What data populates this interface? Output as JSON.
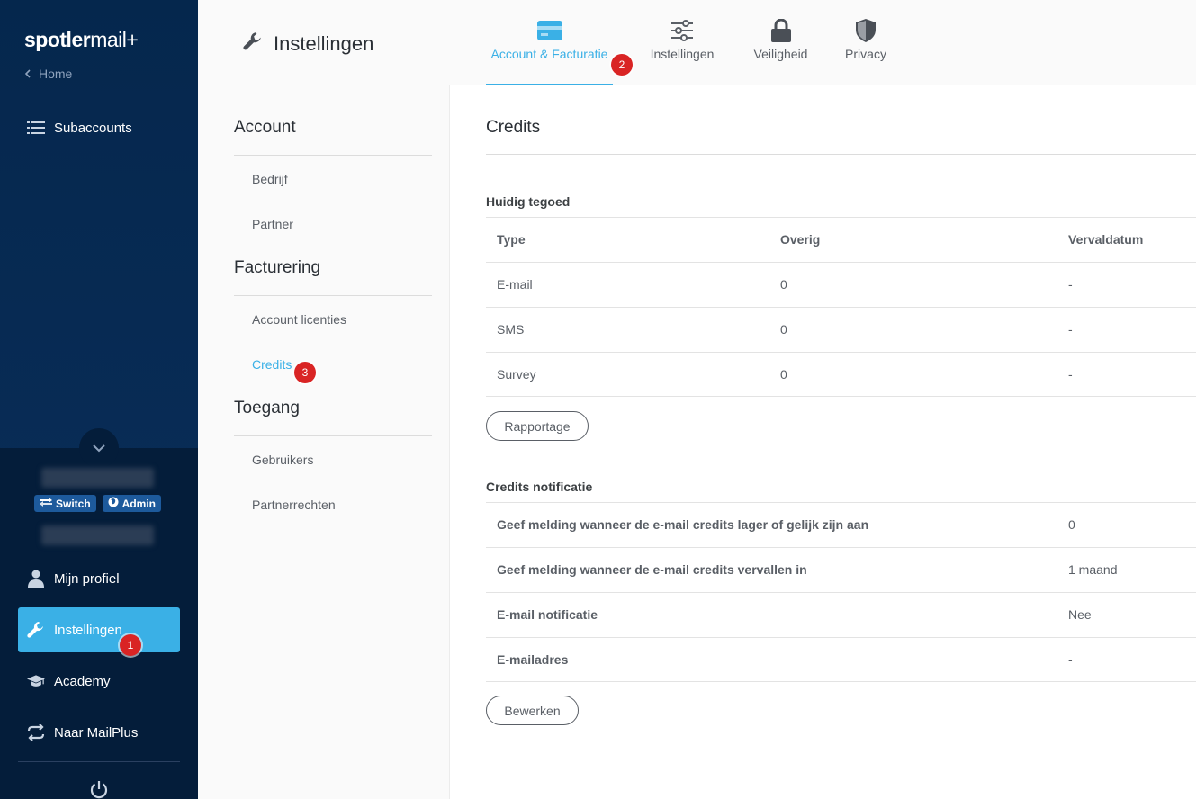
{
  "sidebar": {
    "logo_bold": "spotler",
    "logo_light": "mail+",
    "home_label": "Home",
    "top_items": [
      {
        "label": "Subaccounts",
        "icon": "list-icon"
      }
    ],
    "chips": [
      {
        "label": "Switch",
        "icon": "switch-icon"
      },
      {
        "label": "Admin",
        "icon": "globe-icon"
      }
    ],
    "bottom_items": [
      {
        "label": "Mijn profiel",
        "icon": "user-icon"
      },
      {
        "label": "Instellingen",
        "icon": "wrench-icon",
        "active": true
      },
      {
        "label": "Academy",
        "icon": "graduation-cap-icon"
      },
      {
        "label": "Naar MailPlus",
        "icon": "arrows-swap-icon"
      }
    ]
  },
  "header": {
    "title": "Instellingen",
    "tabs": [
      {
        "label": "Account & Facturatie",
        "icon": "credit-card-icon",
        "active": true
      },
      {
        "label": "Instellingen",
        "icon": "sliders-icon"
      },
      {
        "label": "Veiligheid",
        "icon": "lock-icon"
      },
      {
        "label": "Privacy",
        "icon": "shield-icon"
      }
    ]
  },
  "subnav": {
    "groups": [
      {
        "title": "Account",
        "links": [
          "Bedrijf",
          "Partner"
        ]
      },
      {
        "title": "Facturering",
        "links": [
          "Account licenties",
          "Credits"
        ]
      },
      {
        "title": "Toegang",
        "links": [
          "Gebruikers",
          "Partnerrechten"
        ]
      }
    ],
    "active_link": "Credits"
  },
  "main": {
    "title": "Credits",
    "balance": {
      "heading": "Huidig tegoed",
      "columns": [
        "Type",
        "Overig",
        "Vervaldatum"
      ],
      "rows": [
        [
          "E-mail",
          "0",
          "-"
        ],
        [
          "SMS",
          "0",
          "-"
        ],
        [
          "Survey",
          "0",
          "-"
        ]
      ],
      "button": "Rapportage"
    },
    "notification": {
      "heading": "Credits notificatie",
      "rows": [
        [
          "Geef melding wanneer de e-mail credits lager of gelijk zijn aan",
          "0"
        ],
        [
          "Geef melding wanneer de e-mail credits vervallen in",
          "1 maand"
        ],
        [
          "E-mail notificatie",
          "Nee"
        ],
        [
          "E-mailadres",
          "-"
        ]
      ],
      "button": "Bewerken"
    }
  },
  "markers": [
    "1",
    "2",
    "3"
  ],
  "colors": {
    "sidebar": "#05274d",
    "accent": "#3ab0e6",
    "marker": "#d92424"
  }
}
